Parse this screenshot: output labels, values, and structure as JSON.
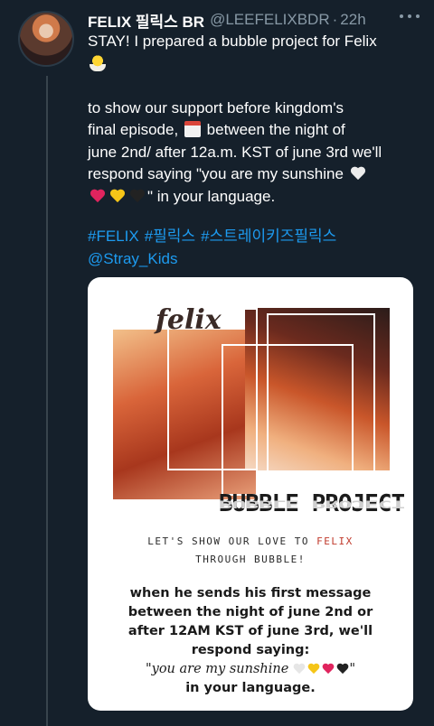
{
  "tweet": {
    "display_name": "FELIX 필릭스 BR",
    "handle": "@LEEFELIXBDR",
    "separator": "·",
    "time": "22h",
    "line1": "STAY! I prepared a bubble project for Felix",
    "line2a": "to show our support before kingdom's",
    "line2b": "final episode,",
    "line2c": "between the night of",
    "line3": "june 2nd/ after 12a.m. KST of june 3rd we'll",
    "line4": "respond saying \"you are my sunshine",
    "line5_end": "\" in your language.",
    "hashtags": [
      "#FELIX",
      "#필릭스",
      "#스트레이키즈필릭스"
    ],
    "mention": "@Stray_Kids"
  },
  "icons": {
    "more": "more-horizontal-icon",
    "chick": "hatching-chick-icon",
    "calendar": "calendar-icon",
    "white_heart": "white-heart-icon",
    "red_heart": "red-heart-icon",
    "yellow_heart": "yellow-heart-icon",
    "black_heart": "black-heart-icon"
  },
  "colors": {
    "background": "#15202b",
    "link": "#1d9bf0",
    "muted": "#8899a6"
  },
  "poster": {
    "script_name": "felix",
    "title": "BUBBLE PROJECT",
    "tagline1_pre": "LET'S SHOW OUR LOVE TO ",
    "tagline1_accent": "FELIX",
    "tagline2": "THROUGH BUBBLE!",
    "msg1": "when he sends his first message",
    "msg2": "between the night of june 2nd or",
    "msg3": "after 12AM KST of june 3rd, we'll",
    "msg4": "respond saying:",
    "msg5_quote": "\"you are my sunshine",
    "msg5_end": "\"",
    "msg6": "in your language."
  }
}
